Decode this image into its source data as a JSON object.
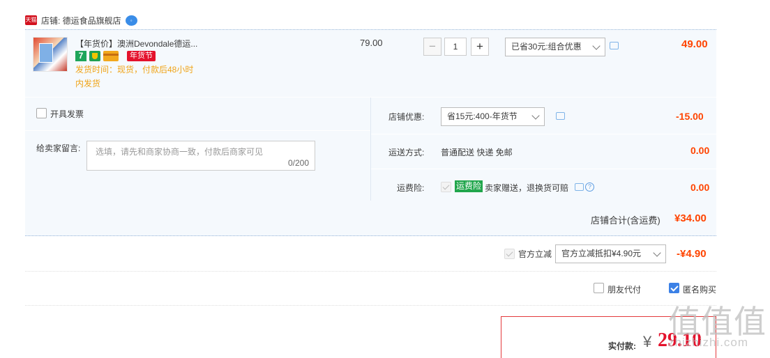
{
  "shop": {
    "tmall_icon_text": "天猫",
    "label": "店铺: 德运食品旗舰店",
    "wangwang_icon": "wangwang-chat-icon"
  },
  "item": {
    "title": "【年货价】澳洲Devondale德运...",
    "badge_seven": "7",
    "badge_nianhuo": "年货节",
    "ship_line1": "发货时间：现货，付款后48小时",
    "ship_line2": "内发货",
    "unit_price": "79.00",
    "quantity": "1",
    "qty_minus": "−",
    "qty_plus": "+",
    "promo_select": "已省30元:组合优惠",
    "total": "49.00"
  },
  "invoice": {
    "label": "开具发票"
  },
  "message": {
    "label": "给卖家留言:",
    "placeholder": "选填，请先和商家协商一致，付款后商家可见",
    "count": "0/200"
  },
  "shop_discount": {
    "label": "店铺优惠:",
    "select": "省15元:400-年货节",
    "amount": "-15.00"
  },
  "delivery": {
    "label": "运送方式:",
    "value": "普通配送 快递 免邮",
    "amount": "0.00"
  },
  "insurance": {
    "label": "运费险:",
    "tag": "运费险",
    "text": "卖家赠送，退换货可赔",
    "amount": "0.00"
  },
  "subtotal": {
    "label": "店铺合计(含运费)",
    "amount": "¥34.00"
  },
  "official": {
    "label": "官方立减",
    "select": "官方立减抵扣¥4.90元",
    "amount": "-¥4.90"
  },
  "options": {
    "friend_pay": "朋友代付",
    "anonymous": "匿名购买"
  },
  "payment": {
    "label": "实付款:",
    "currency": "¥",
    "amount": "29.10"
  },
  "watermark": {
    "glyphs": "值值值",
    "url": "zhizhizhi.com"
  },
  "colors": {
    "accent_red": "#ff4400",
    "tag_red": "#e4122c",
    "row_bg": "#f5f9fd",
    "warn_orange": "#f0a418",
    "check_blue": "#3c81e6",
    "insurance_green": "#21a64c"
  }
}
